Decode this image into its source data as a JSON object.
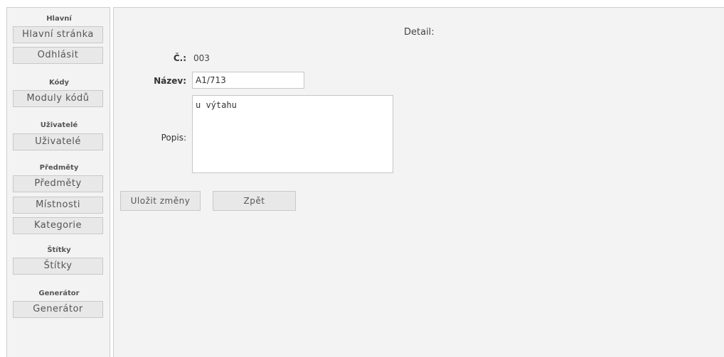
{
  "sidebar": {
    "sections": [
      {
        "title": "Hlavní",
        "buttons": [
          "Hlavní stránka",
          "Odhlásit"
        ]
      },
      {
        "title": "Kódy",
        "buttons": [
          "Moduly kódů"
        ]
      },
      {
        "title": "Uživatelé",
        "buttons": [
          "Uživatelé"
        ]
      },
      {
        "title": "Předměty",
        "buttons": [
          "Předměty",
          "Místnosti",
          "Kategorie"
        ]
      },
      {
        "title": "Štítky",
        "buttons": [
          "Štítky"
        ]
      },
      {
        "title": "Generátor",
        "buttons": [
          "Generátor"
        ]
      }
    ]
  },
  "main": {
    "title": "Detail:",
    "cislo_label": "Č.:",
    "cislo_value": "003",
    "nazev_label": "Název:",
    "nazev_value": "A1/713",
    "popis_label": "Popis:",
    "popis_value": "u výtahu",
    "save_label": "Uložit změny",
    "back_label": "Zpět"
  }
}
